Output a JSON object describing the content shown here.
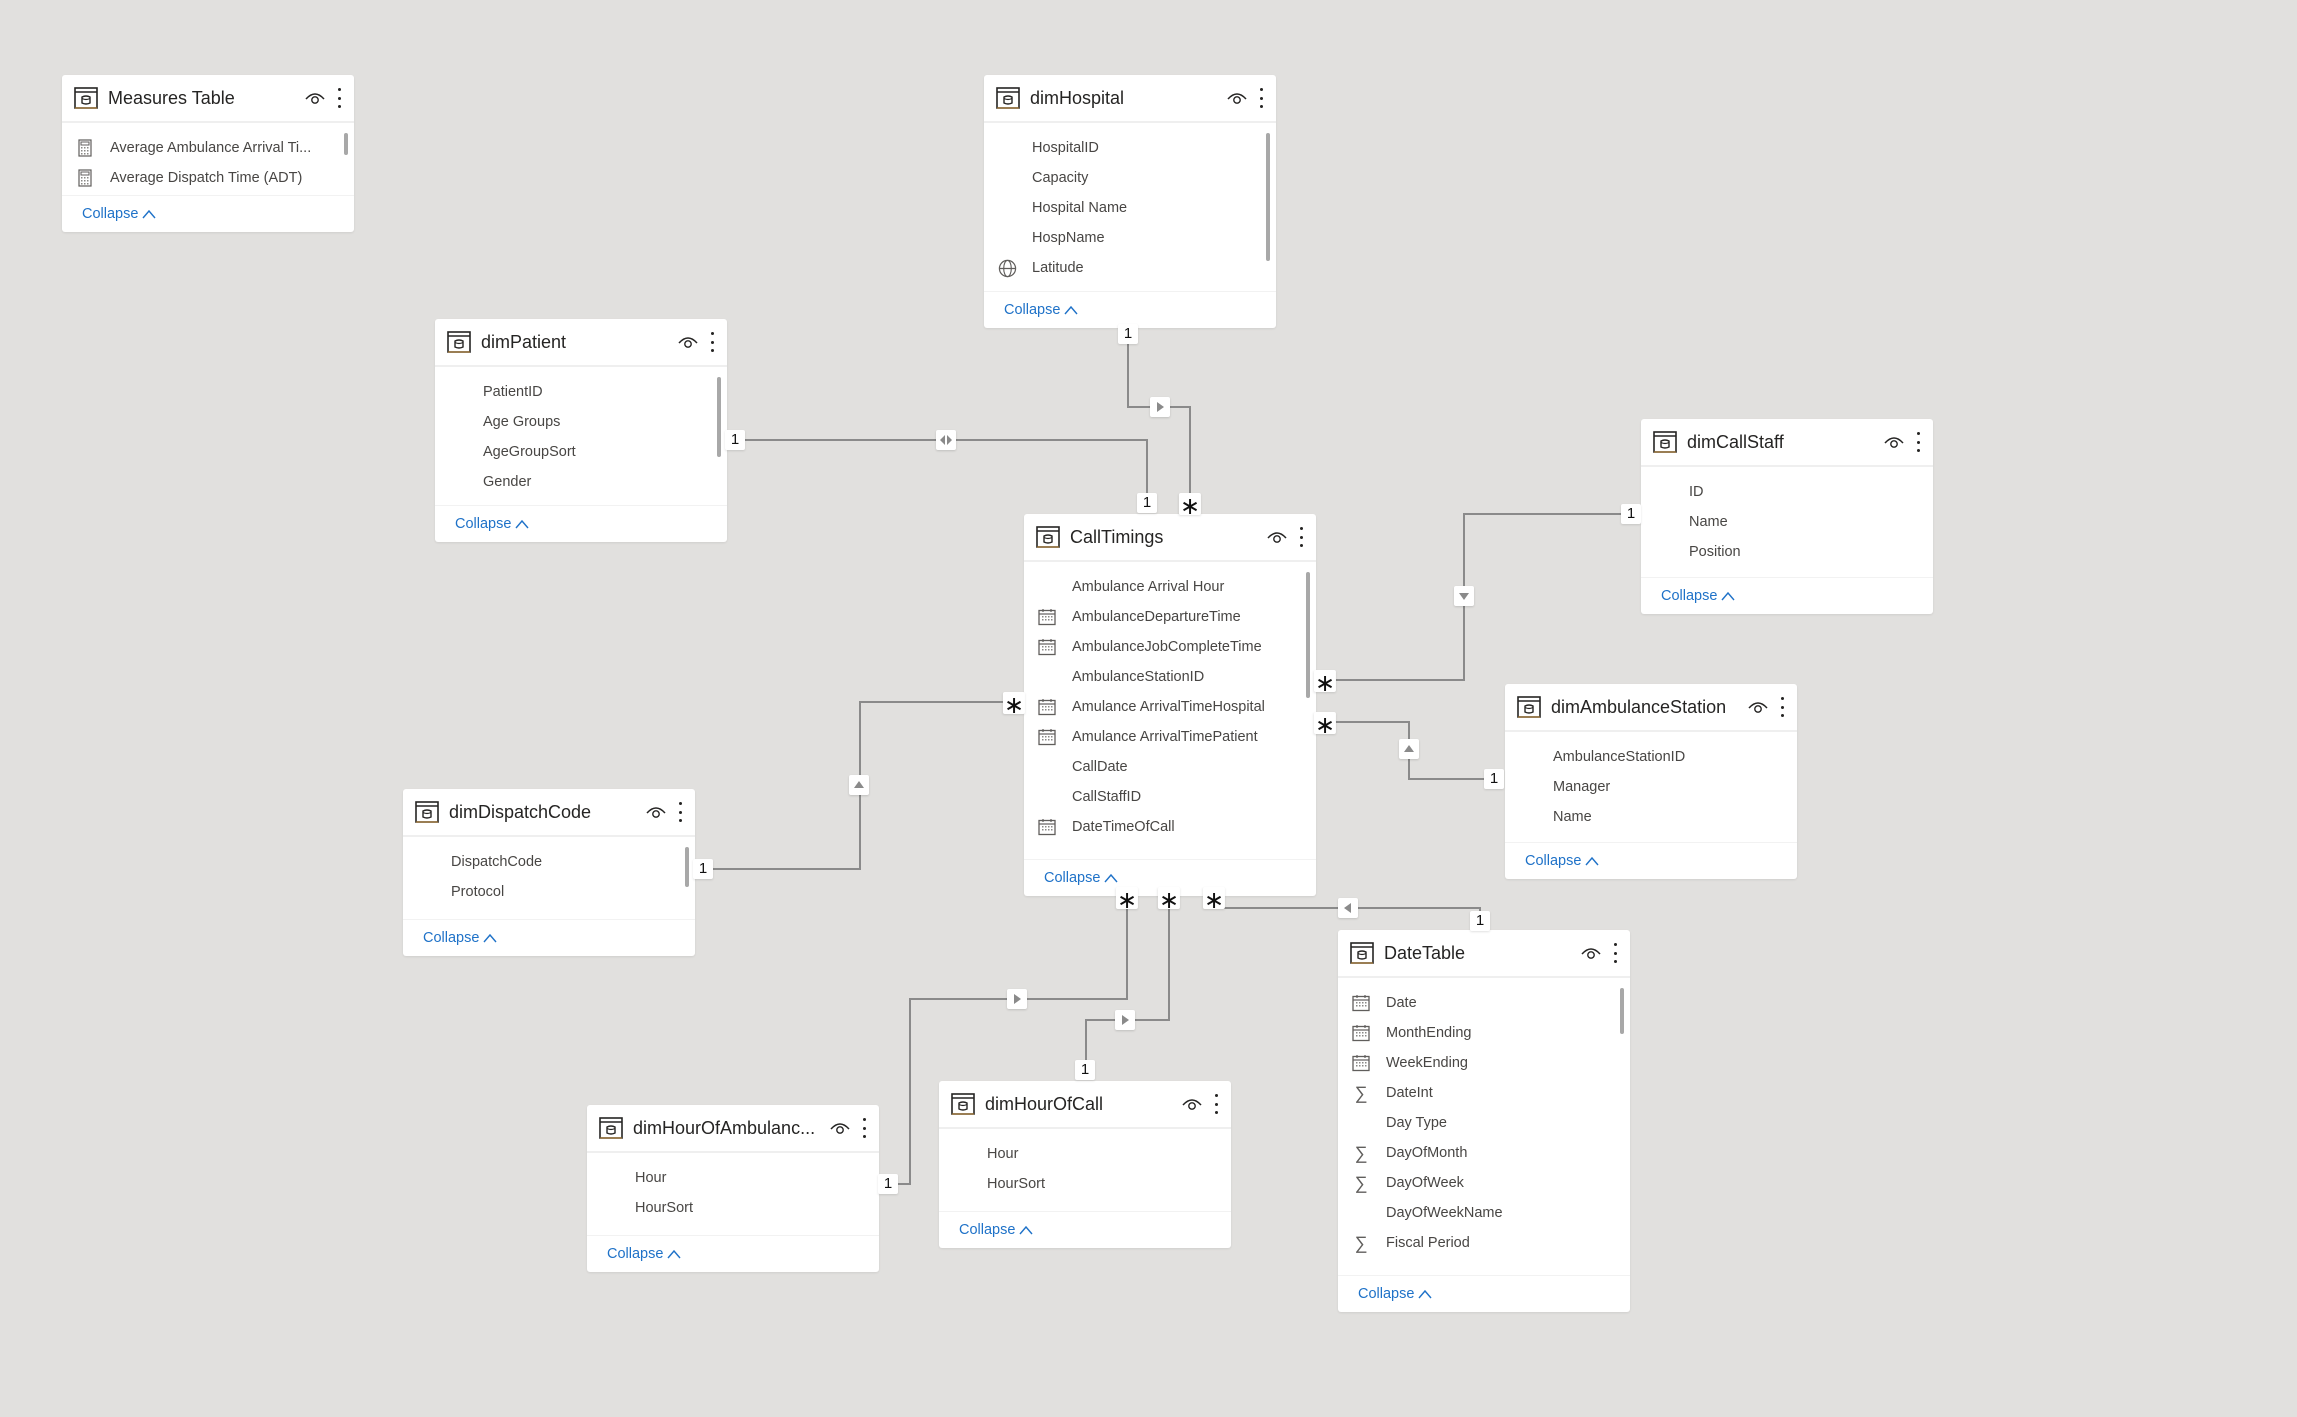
{
  "canvas": {
    "background": "#e1e0de",
    "line_color": "#8a8a8a",
    "link_color": "#1f72c8"
  },
  "common": {
    "collapse_label": "Collapse"
  },
  "tables": {
    "measures": {
      "title": "Measures Table",
      "fields": [
        {
          "name": "Average Ambulance Arrival Ti...",
          "icon": "calculator-icon"
        },
        {
          "name": "Average Dispatch Time (ADT)",
          "icon": "calculator-icon"
        }
      ]
    },
    "dimHospital": {
      "title": "dimHospital",
      "fields": [
        {
          "name": "HospitalID",
          "icon": ""
        },
        {
          "name": "Capacity",
          "icon": ""
        },
        {
          "name": "Hospital Name",
          "icon": ""
        },
        {
          "name": "HospName",
          "icon": ""
        },
        {
          "name": "Latitude",
          "icon": "globe-icon"
        }
      ]
    },
    "dimPatient": {
      "title": "dimPatient",
      "fields": [
        {
          "name": "PatientID",
          "icon": ""
        },
        {
          "name": "Age Groups",
          "icon": ""
        },
        {
          "name": "AgeGroupSort",
          "icon": ""
        },
        {
          "name": "Gender",
          "icon": ""
        }
      ]
    },
    "dimCallStaff": {
      "title": "dimCallStaff",
      "fields": [
        {
          "name": "ID",
          "icon": ""
        },
        {
          "name": "Name",
          "icon": ""
        },
        {
          "name": "Position",
          "icon": ""
        }
      ]
    },
    "callTimings": {
      "title": "CallTimings",
      "fields": [
        {
          "name": "Ambulance Arrival Hour",
          "icon": ""
        },
        {
          "name": "AmbulanceDepartureTime",
          "icon": "calendar-icon"
        },
        {
          "name": "AmbulanceJobCompleteTime",
          "icon": "calendar-icon"
        },
        {
          "name": "AmbulanceStationID",
          "icon": ""
        },
        {
          "name": "Amulance ArrivalTimeHospital",
          "icon": "calendar-icon"
        },
        {
          "name": "Amulance ArrivalTimePatient",
          "icon": "calendar-icon"
        },
        {
          "name": "CallDate",
          "icon": ""
        },
        {
          "name": "CallStaffID",
          "icon": ""
        },
        {
          "name": "DateTimeOfCall",
          "icon": "calendar-icon"
        }
      ]
    },
    "dimAmbulanceStation": {
      "title": "dimAmbulanceStation",
      "fields": [
        {
          "name": "AmbulanceStationID",
          "icon": ""
        },
        {
          "name": "Manager",
          "icon": ""
        },
        {
          "name": "Name",
          "icon": ""
        }
      ]
    },
    "dimDispatchCode": {
      "title": "dimDispatchCode",
      "fields": [
        {
          "name": "DispatchCode",
          "icon": ""
        },
        {
          "name": "Protocol",
          "icon": ""
        }
      ]
    },
    "dateTable": {
      "title": "DateTable",
      "fields": [
        {
          "name": "Date",
          "icon": "calendar-icon"
        },
        {
          "name": "MonthEnding",
          "icon": "calendar-icon"
        },
        {
          "name": "WeekEnding",
          "icon": "calendar-icon"
        },
        {
          "name": "DateInt",
          "icon": "sigma-icon"
        },
        {
          "name": "Day Type",
          "icon": ""
        },
        {
          "name": "DayOfMonth",
          "icon": "sigma-icon"
        },
        {
          "name": "DayOfWeek",
          "icon": "sigma-icon"
        },
        {
          "name": "DayOfWeekName",
          "icon": ""
        },
        {
          "name": "Fiscal Period",
          "icon": "sigma-icon"
        }
      ]
    },
    "dimHourOfAmbulance": {
      "title": "dimHourOfAmbulanc...",
      "fields": [
        {
          "name": "Hour",
          "icon": ""
        },
        {
          "name": "HourSort",
          "icon": ""
        }
      ]
    },
    "dimHourOfCall": {
      "title": "dimHourOfCall",
      "fields": [
        {
          "name": "Hour",
          "icon": ""
        },
        {
          "name": "HourSort",
          "icon": ""
        }
      ]
    }
  },
  "relationships": [
    {
      "from": "dimHospital",
      "to": "CallTimings",
      "from_cardinality": "1",
      "to_cardinality": "*",
      "direction": "single"
    },
    {
      "from": "dimPatient",
      "to": "CallTimings",
      "from_cardinality": "1",
      "to_cardinality": "1",
      "direction": "both"
    },
    {
      "from": "dimCallStaff",
      "to": "CallTimings",
      "from_cardinality": "1",
      "to_cardinality": "*",
      "direction": "single"
    },
    {
      "from": "dimAmbulanceStation",
      "to": "CallTimings",
      "from_cardinality": "1",
      "to_cardinality": "*",
      "direction": "single"
    },
    {
      "from": "dimDispatchCode",
      "to": "CallTimings",
      "from_cardinality": "1",
      "to_cardinality": "*",
      "direction": "single"
    },
    {
      "from": "dimHourOfAmbulance",
      "to": "CallTimings",
      "from_cardinality": "1",
      "to_cardinality": "*",
      "direction": "single"
    },
    {
      "from": "dimHourOfCall",
      "to": "CallTimings",
      "from_cardinality": "1",
      "to_cardinality": "*",
      "direction": "single"
    },
    {
      "from": "DateTable",
      "to": "CallTimings",
      "from_cardinality": "1",
      "to_cardinality": "*",
      "direction": "single"
    }
  ]
}
